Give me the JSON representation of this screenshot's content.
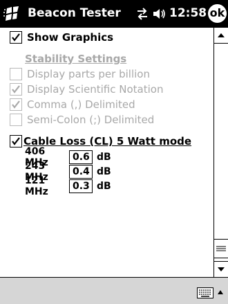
{
  "titlebar": {
    "app_title": "Beacon Tester",
    "time": "12:58",
    "ok_label": "ok",
    "icons": [
      "windows-start-icon",
      "connectivity-icon",
      "volume-icon"
    ]
  },
  "settings": {
    "show_graphics": {
      "label": "Show Graphics",
      "checked": true
    },
    "stability_title": "Stability Settings",
    "stability_options": [
      {
        "label": "Display parts per billion",
        "checked": false,
        "enabled": false
      },
      {
        "label": "Display Scientific Notation",
        "checked": true,
        "enabled": false
      },
      {
        "label": "Comma (,) Delimited",
        "checked": true,
        "enabled": false
      },
      {
        "label": "Semi-Colon (;) Delimited",
        "checked": false,
        "enabled": false
      }
    ],
    "cable_loss": {
      "label": "Cable Loss  (CL)  5 Watt mode",
      "checked": true
    },
    "frequencies": [
      {
        "label": "406 MHz",
        "value": "0.6",
        "unit": "dB"
      },
      {
        "label": "243 MHz",
        "value": "0.4",
        "unit": "dB"
      },
      {
        "label": "121 MHz",
        "value": "0.3",
        "unit": "dB"
      }
    ]
  },
  "taskbar": {
    "icons": [
      "keyboard-icon",
      "sip-arrow-up-icon"
    ]
  }
}
